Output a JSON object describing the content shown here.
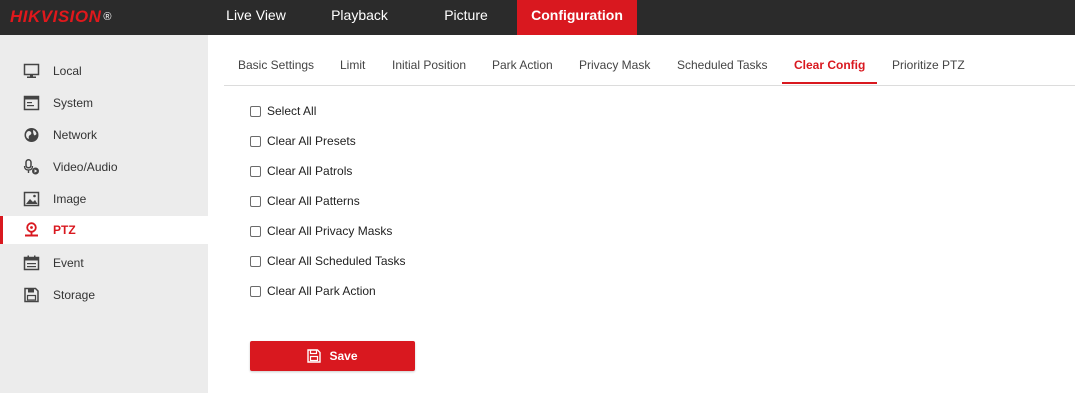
{
  "brand": {
    "logo_text": "HIKVISION",
    "registered": "®",
    "accent": "#d9181f"
  },
  "nav": {
    "items": [
      {
        "label": "Live View"
      },
      {
        "label": "Playback"
      },
      {
        "label": "Picture"
      },
      {
        "label": "Configuration",
        "active": true
      }
    ]
  },
  "sidebar": {
    "items": [
      {
        "label": "Local",
        "icon": "monitor-icon"
      },
      {
        "label": "System",
        "icon": "window-icon"
      },
      {
        "label": "Network",
        "icon": "globe-icon"
      },
      {
        "label": "Video/Audio",
        "icon": "microphone-icon"
      },
      {
        "label": "Image",
        "icon": "image-icon"
      },
      {
        "label": "PTZ",
        "icon": "ptz-camera-icon",
        "active": true
      },
      {
        "label": "Event",
        "icon": "calendar-icon"
      },
      {
        "label": "Storage",
        "icon": "storage-icon"
      }
    ]
  },
  "tabs": {
    "items": [
      {
        "label": "Basic Settings"
      },
      {
        "label": "Limit"
      },
      {
        "label": "Initial Position"
      },
      {
        "label": "Park Action"
      },
      {
        "label": "Privacy Mask"
      },
      {
        "label": "Scheduled Tasks"
      },
      {
        "label": "Clear Config",
        "active": true
      },
      {
        "label": "Prioritize PTZ"
      }
    ]
  },
  "options": {
    "items": [
      {
        "label": "Select All",
        "checked": false
      },
      {
        "label": "Clear All Presets",
        "checked": false
      },
      {
        "label": "Clear All Patrols",
        "checked": false
      },
      {
        "label": "Clear All Patterns",
        "checked": false
      },
      {
        "label": "Clear All Privacy Masks",
        "checked": false
      },
      {
        "label": "Clear All Scheduled Tasks",
        "checked": false
      },
      {
        "label": "Clear All Park Action",
        "checked": false
      }
    ]
  },
  "actions": {
    "save_label": "Save",
    "save_icon": "save-icon"
  }
}
